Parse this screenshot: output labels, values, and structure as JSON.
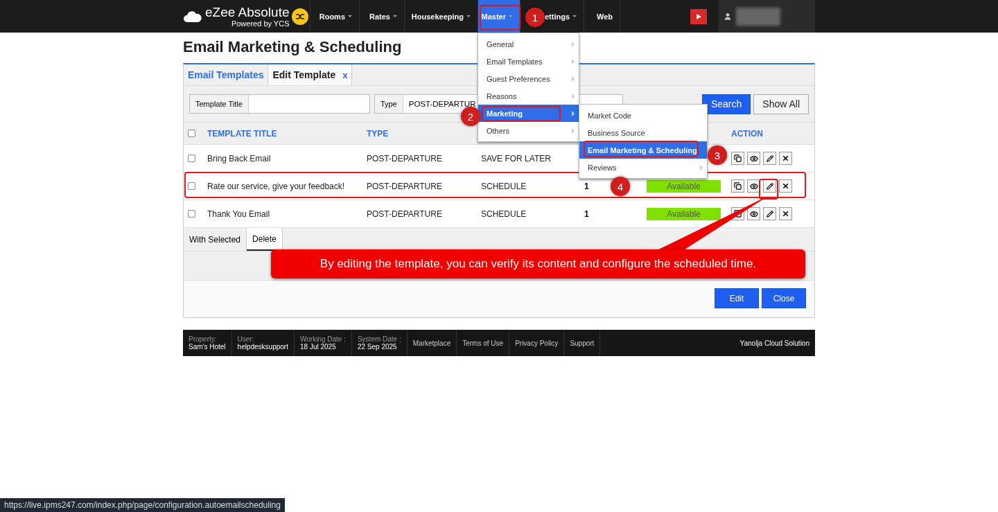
{
  "nav": {
    "brand": "eZee Absolute",
    "brand_sub": "Powered by YCS",
    "items": [
      {
        "label": "Rooms",
        "selected": false,
        "dropdown": true
      },
      {
        "label": "Rates",
        "selected": false,
        "dropdown": true
      },
      {
        "label": "Housekeeping",
        "selected": false,
        "dropdown": true
      },
      {
        "label": "Master",
        "selected": true,
        "dropdown": true
      },
      {
        "label": "ettings",
        "selected": false,
        "dropdown": true
      },
      {
        "label": "Web",
        "selected": false,
        "dropdown": false
      }
    ]
  },
  "menu": {
    "items": [
      {
        "label": "General",
        "selected": false,
        "submenu": true
      },
      {
        "label": "Email Templates",
        "selected": false,
        "submenu": true
      },
      {
        "label": "Guest Preferences",
        "selected": false,
        "submenu": true
      },
      {
        "label": "Reasons",
        "selected": false,
        "submenu": true
      },
      {
        "label": "Marketing",
        "selected": true,
        "submenu": true
      },
      {
        "label": "Others",
        "selected": false,
        "submenu": true
      }
    ],
    "submenu": [
      {
        "label": "Market Code",
        "selected": false,
        "submenu": false
      },
      {
        "label": "Business Source",
        "selected": false,
        "submenu": false
      },
      {
        "label": "Email Marketing & Scheduling",
        "selected": true,
        "submenu": false
      },
      {
        "label": "Reviews",
        "selected": false,
        "submenu": true
      }
    ]
  },
  "page_title": "Email Marketing & Scheduling",
  "tabs": [
    {
      "label": "Email Templates",
      "selected": true,
      "closable": false
    },
    {
      "label": "Edit Template",
      "selected": false,
      "closable": true,
      "close": "x"
    }
  ],
  "filters": {
    "title_label": "Template Title",
    "type_label": "Type",
    "type_value": "POST-DEPARTUR",
    "search": "Search",
    "show_all": "Show All"
  },
  "table": {
    "columns": [
      "TEMPLATE TITLE",
      "TYPE",
      "ACTION"
    ],
    "select_all": false,
    "rows": [
      {
        "title": "Bring Back Email",
        "type": "POST-DEPARTURE",
        "mode": "SAVE FOR LATER",
        "checked": false,
        "highlighted": false
      },
      {
        "title": "Rate our service, give your feedback!",
        "type": "POST-DEPARTURE",
        "mode": "SCHEDULE",
        "count": "1",
        "status": "Available",
        "color": "#80e000",
        "checked": false,
        "highlighted": true
      },
      {
        "title": "Thank You Email",
        "type": "POST-DEPARTURE",
        "mode": "SCHEDULE",
        "count": "1",
        "status": "Available",
        "color": "#80e000",
        "checked": false,
        "highlighted": false
      }
    ]
  },
  "bulk": {
    "label": "With Selected",
    "action": "Delete"
  },
  "buttons": [
    "Edit",
    "Close"
  ],
  "footer": {
    "fields": [
      {
        "label": "Property:",
        "value": "Sam's Hotel"
      },
      {
        "label": "User:",
        "value": "helpdesksupport"
      },
      {
        "label": "Working Date :",
        "value": "18 Jul 2025"
      },
      {
        "label": "System Date :",
        "value": "22 Sep 2025"
      }
    ],
    "links": [
      "Marketplace",
      "Terms of Use",
      "Privacy Policy",
      "Support"
    ],
    "company": "Yanolja Cloud Solution"
  },
  "annotations": {
    "steps": [
      "1",
      "2",
      "3",
      "4"
    ],
    "callout": "By editing the template, you can verify its content and configure the scheduled time."
  },
  "status_url": "https://live.ipms247.com/index.php/page/configuration.autoemailscheduling"
}
